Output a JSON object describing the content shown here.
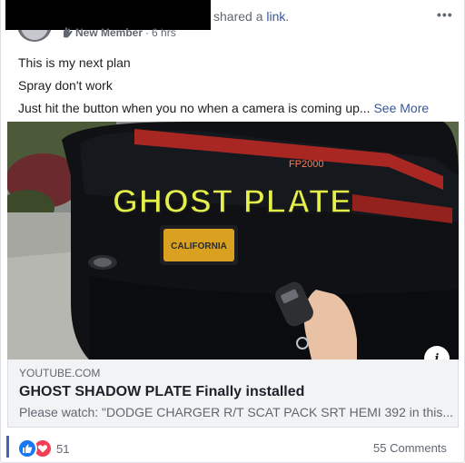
{
  "header": {
    "shared_text": "shared a",
    "link_word": "link",
    "member_badge": "New Member",
    "separator": "·",
    "time": "6 hrs",
    "more_label": "•••"
  },
  "post_text": {
    "line1": "This is my next plan",
    "line2": "Spray don't work",
    "line3": "Just hit the button when you no when a camera is coming up...",
    "see_more": "See More"
  },
  "media": {
    "overlay_text": "GHOST PLATE",
    "brand_text": "FP2000",
    "plate_text": "CALIFORNIA",
    "info_icon": "i"
  },
  "link_preview": {
    "domain": "YOUTUBE.COM",
    "title": "GHOST SHADOW PLATE Finally installed",
    "description": "Please watch: \"DODGE CHARGER R/T SCAT PACK SRT HEMI 392 in this..."
  },
  "footer": {
    "reaction_count": "51",
    "comments": "55 Comments"
  },
  "colors": {
    "link_blue": "#385898",
    "like_blue": "#1877f2",
    "love_red": "#f33e58",
    "overlay_yellow": "#e4f14a"
  }
}
